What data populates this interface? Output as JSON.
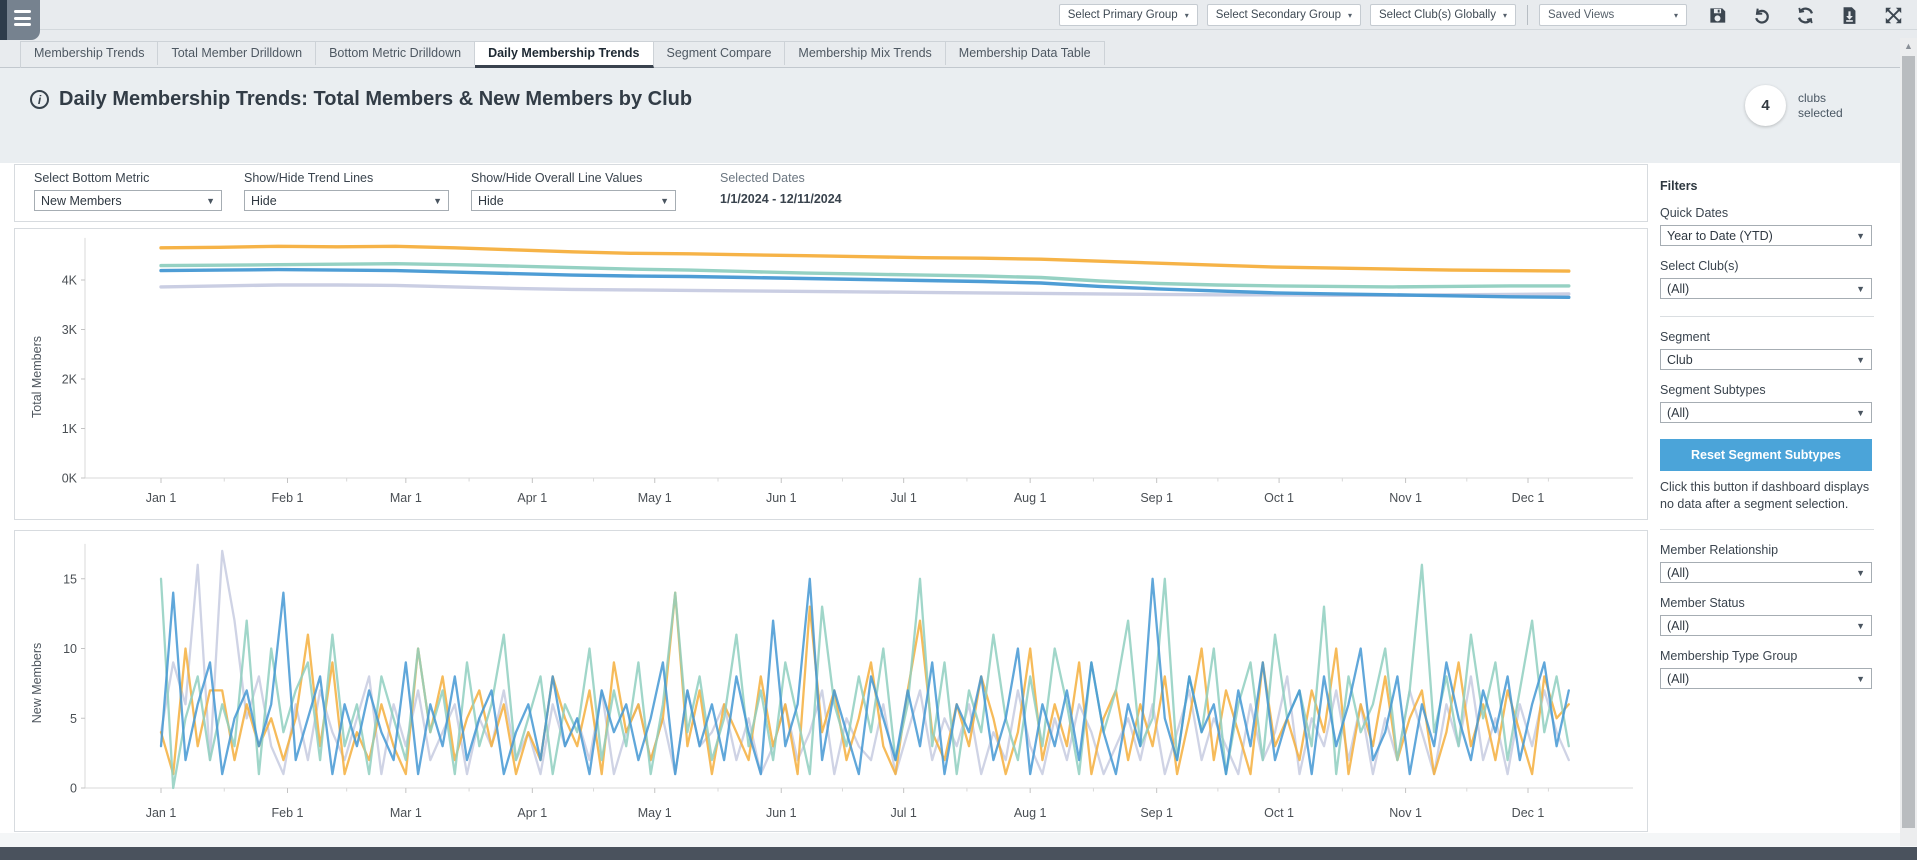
{
  "toolbar": {
    "title": "Membership Trends",
    "primary_group": "Select Primary Group",
    "secondary_group": "Select Secondary Group",
    "clubs_globally": "Select Club(s) Globally",
    "saved_views": "Saved Views"
  },
  "tabs": [
    {
      "label": "Membership Trends"
    },
    {
      "label": "Total Member Drilldown"
    },
    {
      "label": "Bottom Metric Drilldown"
    },
    {
      "label": "Daily Membership Trends"
    },
    {
      "label": "Segment Compare"
    },
    {
      "label": "Membership Mix Trends"
    },
    {
      "label": "Membership Data Table"
    }
  ],
  "page": {
    "title": "Daily Membership Trends: Total Members & New Members by Club",
    "badge_count": "4",
    "badge_line1": "clubs",
    "badge_line2": "selected"
  },
  "controls": {
    "bottom_metric": {
      "label": "Select Bottom Metric",
      "value": "New Members"
    },
    "trend_lines": {
      "label": "Show/Hide Trend Lines",
      "value": "Hide"
    },
    "overall_values": {
      "label": "Show/Hide Overall Line Values",
      "value": "Hide"
    },
    "selected_dates": {
      "label": "Selected Dates",
      "value": "1/1/2024 - 12/11/2024"
    }
  },
  "filters": {
    "title": "Filters",
    "items": [
      {
        "label": "Quick Dates",
        "value": "Year to Date (YTD)"
      },
      {
        "label": "Select Club(s)",
        "value": "(All)"
      },
      {
        "label": "Segment",
        "value": "Club"
      },
      {
        "label": "Segment Subtypes",
        "value": "(All)"
      },
      {
        "label": "Member Relationship",
        "value": "(All)"
      },
      {
        "label": "Member Status",
        "value": "(All)"
      },
      {
        "label": "Membership Type Group",
        "value": "(All)"
      }
    ],
    "reset_button": "Reset Segment Subtypes",
    "reset_note": "Click this button if dashboard displays no data after a segment selection."
  },
  "colors": {
    "accent_blue": "#4BA4D9",
    "dark_bottom_bar": "#4A525D",
    "amber": "#F5AF3D",
    "teal": "#8FCFC0",
    "blue": "#4498D3",
    "lavender": "#C7CBE1"
  },
  "chart_data": [
    {
      "type": "line",
      "ylabel": "Total Members",
      "x_tick_labels": [
        "Jan 1",
        "Feb 1",
        "Mar 1",
        "Apr 1",
        "May 1",
        "Jun 1",
        "Jul 1",
        "Aug 1",
        "Sep 1",
        "Oct 1",
        "Nov 1",
        "Dec 1"
      ],
      "month_day_offsets": [
        0,
        31,
        60,
        91,
        121,
        152,
        182,
        213,
        244,
        274,
        305,
        335
      ],
      "total_days": 345,
      "x_range_label": "Jan 1, 2024 - Dec 11, 2024",
      "ylim": [
        0,
        4.85
      ],
      "y_tick_values": [
        0,
        1,
        2,
        3,
        4
      ],
      "y_tick_labels": [
        "0K",
        "1K",
        "2K",
        "3K",
        "4K"
      ],
      "units": "thousands of members",
      "grid": false,
      "legend": "none",
      "series": [
        {
          "name": "club-lavender",
          "color": "#C7CBE1",
          "values": [
            3.86,
            3.88,
            3.9,
            3.9,
            3.89,
            3.86,
            3.83,
            3.81,
            3.8,
            3.79,
            3.78,
            3.77,
            3.76,
            3.75,
            3.74,
            3.73,
            3.72,
            3.71,
            3.7,
            3.7,
            3.69,
            3.69,
            3.7,
            3.71,
            3.72
          ]
        },
        {
          "name": "club-amber",
          "color": "#F5AF3D",
          "values": [
            4.65,
            4.66,
            4.68,
            4.67,
            4.68,
            4.65,
            4.61,
            4.57,
            4.54,
            4.53,
            4.51,
            4.49,
            4.47,
            4.45,
            4.44,
            4.42,
            4.38,
            4.34,
            4.3,
            4.26,
            4.24,
            4.22,
            4.2,
            4.19,
            4.18
          ]
        },
        {
          "name": "club-teal",
          "color": "#8FCFC0",
          "values": [
            4.29,
            4.3,
            4.31,
            4.32,
            4.33,
            4.31,
            4.28,
            4.25,
            4.22,
            4.2,
            4.17,
            4.14,
            4.12,
            4.1,
            4.08,
            4.05,
            3.98,
            3.93,
            3.9,
            3.88,
            3.87,
            3.86,
            3.87,
            3.88,
            3.88
          ]
        },
        {
          "name": "club-blue",
          "color": "#4498D3",
          "values": [
            4.19,
            4.2,
            4.21,
            4.2,
            4.19,
            4.16,
            4.13,
            4.1,
            4.08,
            4.07,
            4.05,
            4.03,
            4.01,
            3.99,
            3.97,
            3.94,
            3.87,
            3.82,
            3.78,
            3.74,
            3.72,
            3.7,
            3.68,
            3.66,
            3.65
          ]
        }
      ]
    },
    {
      "type": "line",
      "ylabel": "New Members",
      "x_tick_labels": [
        "Jan 1",
        "Feb 1",
        "Mar 1",
        "Apr 1",
        "May 1",
        "Jun 1",
        "Jul 1",
        "Aug 1",
        "Sep 1",
        "Oct 1",
        "Nov 1",
        "Dec 1"
      ],
      "month_day_offsets": [
        0,
        31,
        60,
        91,
        121,
        152,
        182,
        213,
        244,
        274,
        305,
        335
      ],
      "total_days": 345,
      "ylim": [
        0,
        17.5
      ],
      "y_tick_values": [
        0,
        5,
        10,
        15
      ],
      "y_tick_labels": [
        "0",
        "5",
        "10",
        "15"
      ],
      "units": "members per day",
      "grid": false,
      "legend": "none",
      "series": [
        {
          "name": "club-lavender",
          "color": "#C7CBE1",
          "values": [
            4,
            9,
            6,
            16,
            2,
            17,
            12,
            5,
            8,
            3,
            1,
            6,
            2,
            7,
            4,
            2,
            5,
            8,
            1,
            6,
            3,
            7,
            2,
            4,
            6,
            1,
            5,
            3,
            7,
            2,
            4,
            1,
            6,
            3,
            5,
            2,
            7,
            1,
            4,
            6,
            2,
            5,
            1,
            7,
            3,
            4,
            6,
            2,
            5,
            1,
            3,
            6,
            2,
            4,
            7,
            1,
            5,
            3,
            2,
            6,
            1,
            4,
            7,
            2,
            5,
            3,
            6,
            1,
            4,
            2,
            7,
            3,
            1,
            5,
            2,
            6,
            4,
            1,
            3,
            5,
            2,
            6,
            1,
            4,
            7,
            2,
            5,
            3,
            1,
            6,
            2,
            4,
            8,
            1,
            5,
            3,
            7,
            2,
            6,
            1,
            5,
            2,
            7,
            4,
            1,
            6,
            3,
            8,
            2,
            5,
            1,
            6,
            3,
            7,
            4,
            2
          ]
        },
        {
          "name": "club-amber",
          "color": "#F5AF3D",
          "values": [
            4,
            1,
            10,
            3,
            7,
            7,
            2,
            6,
            3,
            5,
            2,
            5,
            11,
            3,
            9,
            1,
            4,
            2,
            6,
            3,
            1,
            10,
            4,
            8,
            2,
            5,
            7,
            3,
            6,
            1,
            4,
            2,
            8,
            5,
            3,
            7,
            1,
            9,
            4,
            6,
            2,
            5,
            14,
            3,
            7,
            1,
            6,
            4,
            2,
            8,
            3,
            6,
            1,
            13,
            4,
            7,
            2,
            5,
            9,
            3,
            1,
            7,
            12,
            4,
            2,
            6,
            3,
            8,
            5,
            1,
            4,
            10,
            2,
            6,
            3,
            9,
            1,
            5,
            7,
            2,
            6,
            3,
            8,
            1,
            5,
            10,
            2,
            7,
            4,
            1,
            9,
            3,
            5,
            2,
            7,
            4,
            10,
            1,
            6,
            3,
            8,
            2,
            5,
            7,
            1,
            4,
            9,
            3,
            6,
            2,
            7,
            4,
            1,
            8,
            5,
            6
          ]
        },
        {
          "name": "club-teal",
          "color": "#8FCFC0",
          "values": [
            15,
            0,
            5,
            8,
            2,
            6,
            3,
            12,
            1,
            10,
            4,
            7,
            9,
            2,
            11,
            3,
            6,
            1,
            8,
            5,
            2,
            10,
            4,
            7,
            1,
            9,
            3,
            6,
            11,
            2,
            5,
            8,
            1,
            6,
            4,
            10,
            2,
            7,
            3,
            9,
            1,
            6,
            14,
            4,
            8,
            2,
            5,
            11,
            3,
            7,
            2,
            9,
            5,
            1,
            13,
            6,
            3,
            8,
            4,
            10,
            2,
            6,
            15,
            3,
            9,
            1,
            7,
            4,
            11,
            5,
            2,
            8,
            3,
            10,
            6,
            1,
            9,
            4,
            7,
            12,
            3,
            5,
            15,
            2,
            8,
            4,
            10,
            1,
            6,
            9,
            2,
            11,
            5,
            7,
            3,
            13,
            1,
            8,
            4,
            6,
            10,
            2,
            7,
            16,
            4,
            8,
            3,
            11,
            5,
            9,
            2,
            7,
            12,
            4,
            8,
            3
          ]
        },
        {
          "name": "club-blue",
          "color": "#4498D3",
          "values": [
            3,
            14,
            2,
            6,
            9,
            1,
            5,
            7,
            3,
            6,
            14,
            2,
            5,
            8,
            1,
            6,
            3,
            7,
            4,
            2,
            9,
            1,
            6,
            3,
            8,
            2,
            5,
            7,
            1,
            4,
            6,
            2,
            8,
            3,
            5,
            1,
            7,
            4,
            6,
            2,
            5,
            9,
            1,
            7,
            3,
            6,
            2,
            8,
            4,
            1,
            12,
            3,
            6,
            15,
            2,
            7,
            4,
            1,
            8,
            5,
            2,
            7,
            3,
            9,
            1,
            6,
            4,
            8,
            2,
            5,
            10,
            1,
            6,
            3,
            7,
            2,
            9,
            4,
            1,
            6,
            3,
            15,
            5,
            2,
            8,
            4,
            6,
            1,
            7,
            3,
            9,
            2,
            5,
            7,
            1,
            8,
            3,
            6,
            10,
            2,
            4,
            8,
            1,
            6,
            3,
            9,
            5,
            2,
            7,
            4,
            8,
            2,
            6,
            9,
            3,
            7
          ]
        }
      ]
    }
  ]
}
